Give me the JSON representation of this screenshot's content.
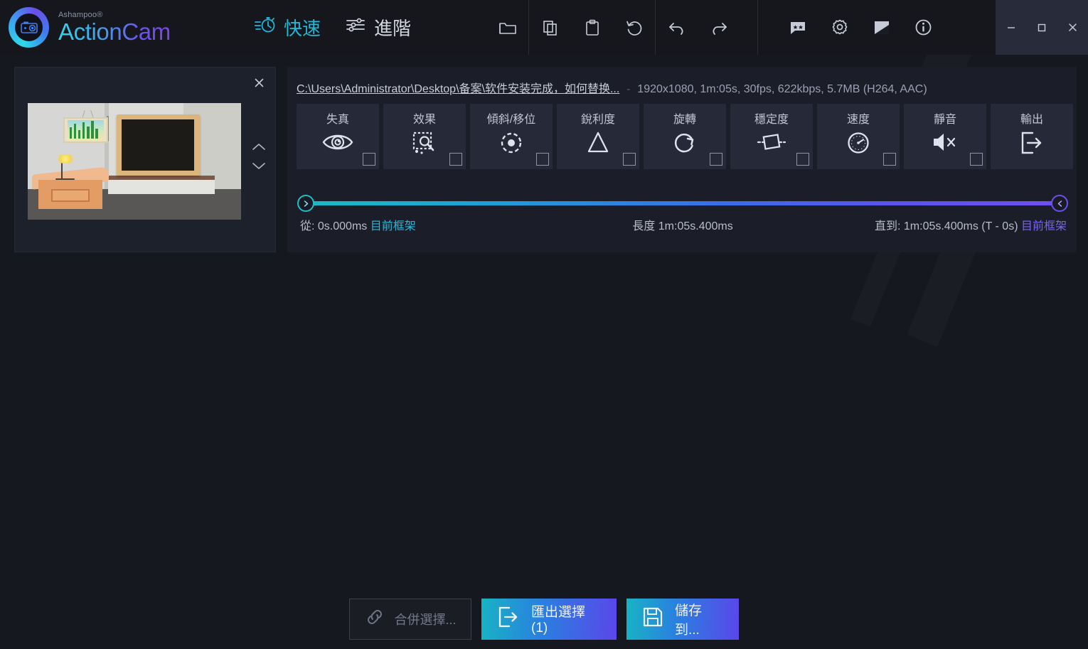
{
  "app": {
    "brand_sup": "Ashampoo®",
    "brand_name": "ActionCam"
  },
  "header": {
    "modes": [
      {
        "label": "快速",
        "icon": "stopwatch-icon",
        "active": true
      },
      {
        "label": "進階",
        "icon": "sliders-icon",
        "active": false
      }
    ],
    "toolbar": [
      {
        "name": "open-folder-icon",
        "label": "開啟"
      },
      {
        "name": "copy-icon",
        "label": "複製"
      },
      {
        "name": "paste-icon",
        "label": "貼上"
      },
      {
        "name": "reset-icon",
        "label": "重設"
      },
      {
        "name": "undo-icon",
        "label": "復原"
      },
      {
        "name": "redo-icon",
        "label": "重做"
      },
      {
        "name": "feedback-icon",
        "label": "意見回饋"
      },
      {
        "name": "settings-gear-icon",
        "label": "設定"
      },
      {
        "name": "theme-icon",
        "label": "佈景主題"
      },
      {
        "name": "info-icon",
        "label": "關於"
      }
    ],
    "window_controls": {
      "minimize": "–",
      "maximize": "□",
      "close": "✕"
    }
  },
  "thumbnail_panel": {
    "close_label": "✕",
    "move_up_label": "︿",
    "move_down_label": "﹀"
  },
  "clip": {
    "path": "C:\\Users\\Administrator\\Desktop\\备案\\软件安装完成，如何替换...",
    "separator": "-",
    "meta": "1920x1080, 1m:05s, 30fps, 622kbps, 5.7MB (H264, AAC)",
    "tools": [
      {
        "label": "失真",
        "icon": "eye-distortion-icon",
        "checkbox": true,
        "checked": false
      },
      {
        "label": "效果",
        "icon": "effects-icon",
        "checkbox": true,
        "checked": false
      },
      {
        "label": "傾斜/移位",
        "icon": "tilt-shift-icon",
        "checkbox": true,
        "checked": false
      },
      {
        "label": "銳利度",
        "icon": "sharpness-icon",
        "checkbox": true,
        "checked": false
      },
      {
        "label": "旋轉",
        "icon": "rotate-icon",
        "checkbox": true,
        "checked": false
      },
      {
        "label": "穩定度",
        "icon": "stabilize-icon",
        "checkbox": true,
        "checked": false
      },
      {
        "label": "速度",
        "icon": "speed-gauge-icon",
        "checkbox": true,
        "checked": false
      },
      {
        "label": "靜音",
        "icon": "mute-icon",
        "checkbox": true,
        "checked": false
      },
      {
        "label": "輸出",
        "icon": "export-icon",
        "checkbox": false,
        "checked": false
      }
    ],
    "timeline": {
      "from_label": "從:",
      "from_value": "0s.000ms",
      "from_link": "目前框架",
      "length_label": "長度",
      "length_value": "1m:05s.400ms",
      "to_label": "直到:",
      "to_value": "1m:05s.400ms (T - 0s)",
      "to_link": "目前框架",
      "start_pct": 0,
      "end_pct": 100
    }
  },
  "bottom_bar": {
    "merge_label": "合併選擇...",
    "merge_icon": "link-icon",
    "export_label": "匯出選擇 (1)",
    "export_icon": "export-icon",
    "save_label": "儲存到...",
    "save_icon": "floppy-save-icon"
  },
  "colors": {
    "accent_cyan": "#1fb6d8",
    "accent_purple": "#6d4fef",
    "window_bg": "#16181f",
    "panel_bg": "#1b1e28",
    "tool_bg": "#262a38"
  }
}
